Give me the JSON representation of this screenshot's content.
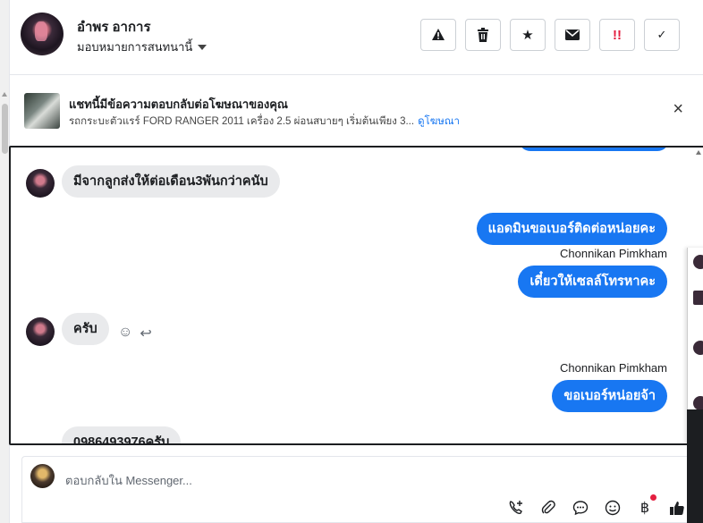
{
  "header": {
    "user_name": "อำพร อาการ",
    "assign_label": "มอบหมายการสนทนานี้",
    "actions": [
      {
        "icon": "warning-icon",
        "glyph": "▲"
      },
      {
        "icon": "trash-icon",
        "glyph": "🗑"
      },
      {
        "icon": "star-icon",
        "glyph": "★"
      },
      {
        "icon": "mail-icon",
        "glyph": "✉"
      },
      {
        "icon": "priority-icon",
        "glyph": "!!"
      },
      {
        "icon": "check-icon",
        "glyph": "✓"
      }
    ]
  },
  "ad_notice": {
    "title": "แชทนี้มีข้อความตอบกลับต่อโฆษณาของคุณ",
    "subtitle": "รถกระบะตัวแรร์ FORD RANGER 2011 เครื่อง 2.5 ผ่อนสบายๆ เริ่มต้นเพียง 3...",
    "link": "ดูโฆษณา",
    "close": "×"
  },
  "messages": [
    {
      "direction": "in",
      "text": "มีจากลูกส่งให้ต่อเดือน3พันกว่าคนับ"
    },
    {
      "direction": "out",
      "text": "แอดมินขอเบอร์ติดต่อหน่อยคะ"
    },
    {
      "direction": "out",
      "sender": "Chonnikan Pimkham",
      "text": "เดี๋ยวให้เซลล์โทรหาคะ"
    },
    {
      "direction": "in",
      "text": "ครับ"
    },
    {
      "direction": "out",
      "sender": "Chonnikan Pimkham",
      "text": "ขอเบอร์หน่อยจ้า"
    },
    {
      "direction": "in",
      "text": "0986493976ครับ"
    }
  ],
  "composer": {
    "placeholder": "ตอบกลับใน Messenger...",
    "tools": [
      "phone-plus-icon",
      "attach-icon",
      "chat-bubble-icon",
      "emoji-icon",
      "baht-icon",
      "thumbs-up-icon"
    ]
  },
  "colors": {
    "outgoing": "#1877f2",
    "incoming": "#e9eaec",
    "link": "#1877f2"
  }
}
